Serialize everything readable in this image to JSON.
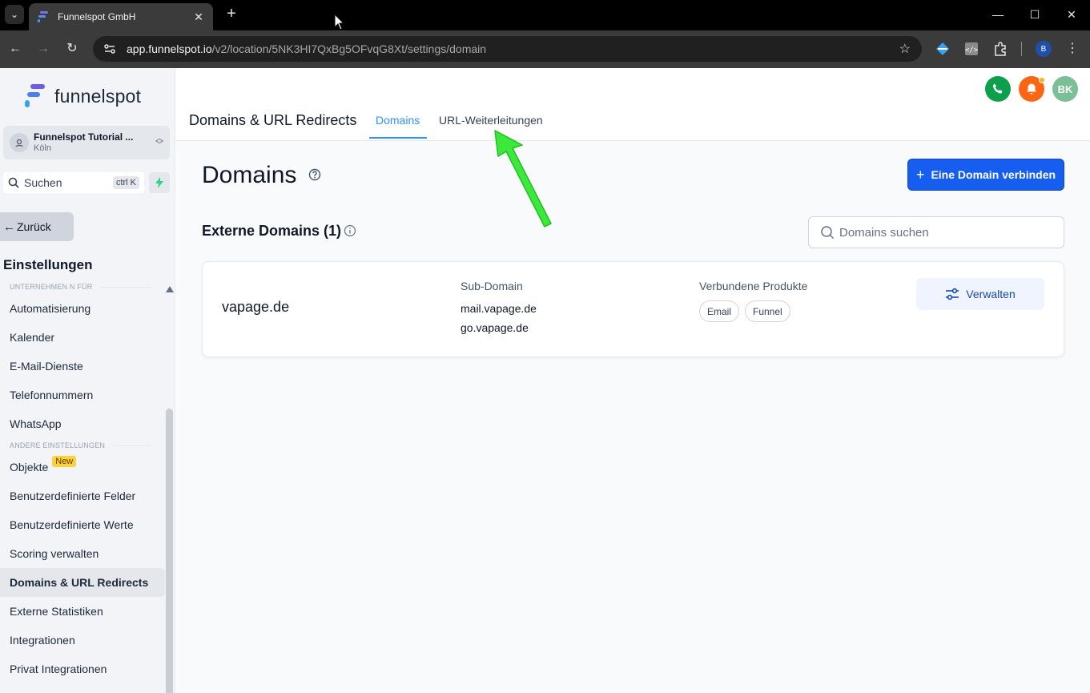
{
  "browser": {
    "tab_title": "Funnelspot GmbH",
    "url_host": "app.funnelspot.io",
    "url_path": "/v2/location/5NK3HI7QxBg5OFvqG8Xt/settings/domain",
    "profile_initial": "B"
  },
  "sidebar": {
    "logo_text": "funnelspot",
    "location": {
      "name": "Funnelspot Tutorial ...",
      "city": "Köln"
    },
    "search_label": "Suchen",
    "search_shortcut": "ctrl K",
    "back_label": "Zurück",
    "settings_heading": "Einstellungen",
    "section_company": "UNTERNEHMEN        N FÜR",
    "items_top": [
      {
        "label": "Automatisierung"
      },
      {
        "label": "Kalender"
      },
      {
        "label": "E-Mail-Dienste"
      },
      {
        "label": "Telefonnummern"
      },
      {
        "label": "WhatsApp"
      }
    ],
    "section_other": "ANDERE EINSTELLUNGEN",
    "items_bottom": [
      {
        "label": "Objekte",
        "badge": "New"
      },
      {
        "label": "Benutzerdefinierte Felder"
      },
      {
        "label": "Benutzerdefinierte Werte"
      },
      {
        "label": "Scoring verwalten"
      },
      {
        "label": "Domains & URL Redirects",
        "active": true
      },
      {
        "label": "Externe Statistiken"
      },
      {
        "label": "Integrationen"
      },
      {
        "label": "Privat Integrationen"
      }
    ]
  },
  "header": {
    "title": "Domains & URL Redirects",
    "tabs": [
      {
        "label": "Domains",
        "active": true
      },
      {
        "label": "URL-Weiterleitungen",
        "active": false
      }
    ],
    "avatar_initials": "BK",
    "colors": {
      "phone": "#0e9f4d",
      "notifications": "#fb6514",
      "avatar": "#7bbf95"
    }
  },
  "main": {
    "title": "Domains",
    "connect_button": "Eine Domain verbinden",
    "external_heading": "Externe Domains (1)",
    "search_placeholder": "Domains suchen",
    "domains": [
      {
        "name": "vapage.de",
        "subdomain_label": "Sub-Domain",
        "subdomains": [
          "mail.vapage.de",
          "go.vapage.de"
        ],
        "products_label": "Verbundene Produkte",
        "products": [
          "Email",
          "Funnel"
        ],
        "manage_label": "Verwalten"
      }
    ]
  },
  "colors": {
    "accent": "#155eef",
    "tab_active": "#2e90fa",
    "annotation_arrow": "#3de83d"
  }
}
